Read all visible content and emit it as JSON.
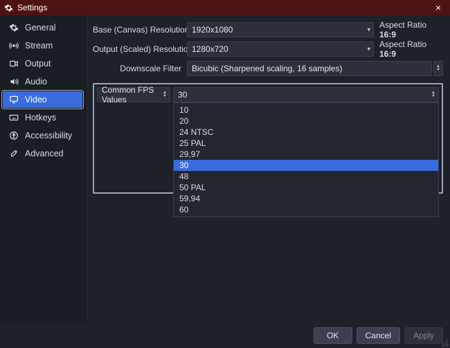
{
  "window": {
    "title": "Settings"
  },
  "sidebar": {
    "items": [
      {
        "label": "General"
      },
      {
        "label": "Stream"
      },
      {
        "label": "Output"
      },
      {
        "label": "Audio"
      },
      {
        "label": "Video"
      },
      {
        "label": "Hotkeys"
      },
      {
        "label": "Accessibility"
      },
      {
        "label": "Advanced"
      }
    ],
    "selected_index": 4
  },
  "video": {
    "base_res_label": "Base (Canvas) Resolution",
    "base_res_value": "1920x1080",
    "base_aspect_prefix": "Aspect Ratio ",
    "base_aspect_value": "16:9",
    "output_res_label": "Output (Scaled) Resolution",
    "output_res_value": "1280x720",
    "output_aspect_prefix": "Aspect Ratio ",
    "output_aspect_value": "16:9",
    "downscale_label": "Downscale Filter",
    "downscale_value": "Bicubic (Sharpened scaling, 16 samples)",
    "fps_label": "Common FPS Values",
    "fps_value": "30",
    "fps_options": [
      "10",
      "20",
      "24 NTSC",
      "25 PAL",
      "29,97",
      "30",
      "48",
      "50 PAL",
      "59,94",
      "60"
    ],
    "fps_selected_index": 5
  },
  "footer": {
    "ok": "OK",
    "cancel": "Cancel",
    "apply": "Apply"
  }
}
